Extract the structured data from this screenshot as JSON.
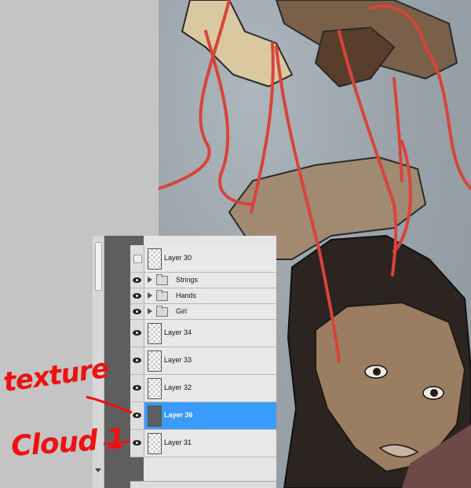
{
  "layers_panel": {
    "rows": [
      {
        "kind": "layer",
        "name": "Layer 30",
        "visible": false,
        "selected": false
      },
      {
        "kind": "group",
        "name": "Strings",
        "visible": true
      },
      {
        "kind": "group",
        "name": "Hands",
        "visible": true
      },
      {
        "kind": "group",
        "name": "Girl",
        "visible": true
      },
      {
        "kind": "layer",
        "name": "Layer 34",
        "visible": true,
        "selected": false
      },
      {
        "kind": "layer",
        "name": "Layer 33",
        "visible": true,
        "selected": false
      },
      {
        "kind": "layer",
        "name": "Layer 32",
        "visible": true,
        "selected": false
      },
      {
        "kind": "layer",
        "name": "Layer 36",
        "visible": true,
        "selected": true
      },
      {
        "kind": "layer",
        "name": "Layer 31",
        "visible": true,
        "selected": false
      }
    ]
  },
  "annotations": {
    "texture": "texture",
    "cloud": "Cloud 1"
  },
  "colors": {
    "annotation": "#ee1111",
    "selection": "#3a9bff",
    "string": "#d9443a"
  }
}
